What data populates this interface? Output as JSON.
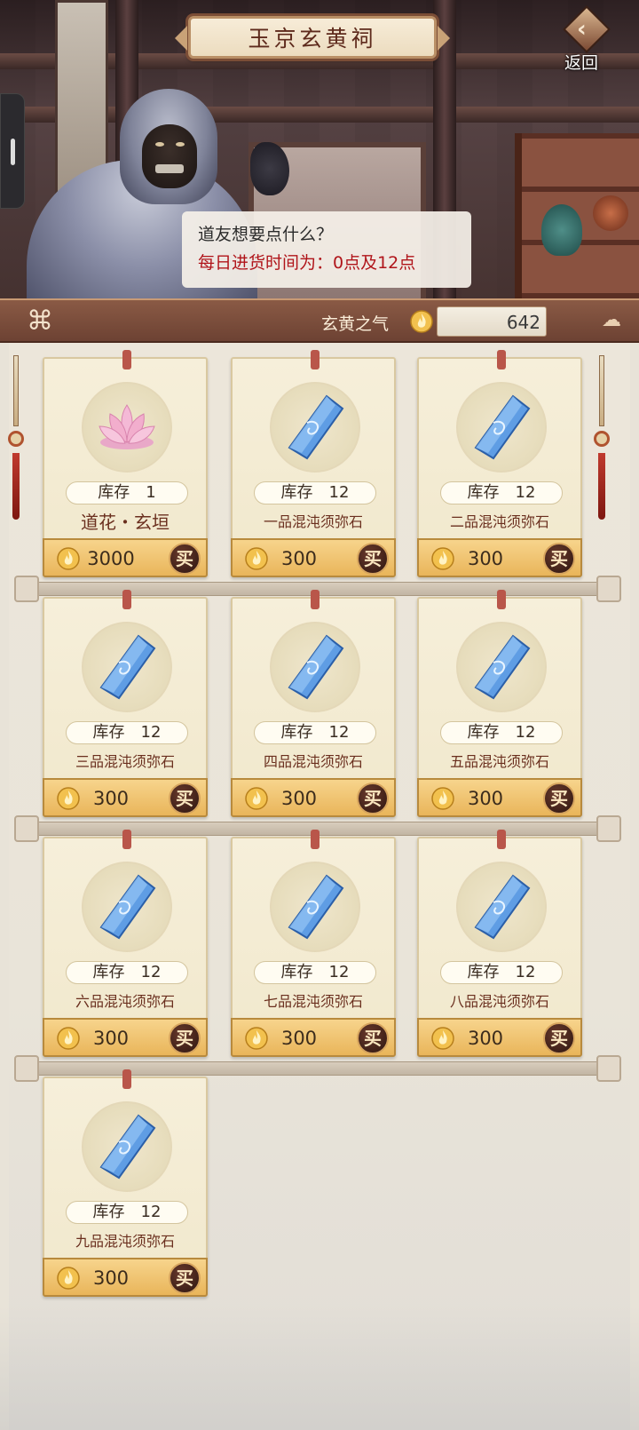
{
  "header": {
    "title": "玉京玄黄祠",
    "back_label": "返回"
  },
  "dialog": {
    "line1": "道友想要点什么？",
    "line2": "每日进货时间为：0点及12点"
  },
  "currency": {
    "label": "玄黄之气",
    "value": "642",
    "icon": "flame-coin-icon"
  },
  "stock_label": "库存",
  "buy_label": "买",
  "items": [
    {
      "name": "道花・玄垣",
      "stock": "1",
      "price": "3000",
      "icon": "lotus-icon"
    },
    {
      "name": "一品混沌须弥石",
      "stock": "12",
      "price": "300",
      "icon": "crystal-icon"
    },
    {
      "name": "二品混沌须弥石",
      "stock": "12",
      "price": "300",
      "icon": "crystal-icon"
    },
    {
      "name": "三品混沌须弥石",
      "stock": "12",
      "price": "300",
      "icon": "crystal-icon"
    },
    {
      "name": "四品混沌须弥石",
      "stock": "12",
      "price": "300",
      "icon": "crystal-icon"
    },
    {
      "name": "五品混沌须弥石",
      "stock": "12",
      "price": "300",
      "icon": "crystal-icon"
    },
    {
      "name": "六品混沌须弥石",
      "stock": "12",
      "price": "300",
      "icon": "crystal-icon"
    },
    {
      "name": "七品混沌须弥石",
      "stock": "12",
      "price": "300",
      "icon": "crystal-icon"
    },
    {
      "name": "八品混沌须弥石",
      "stock": "12",
      "price": "300",
      "icon": "crystal-icon"
    },
    {
      "name": "九品混沌须弥石",
      "stock": "12",
      "price": "300",
      "icon": "crystal-icon"
    }
  ]
}
